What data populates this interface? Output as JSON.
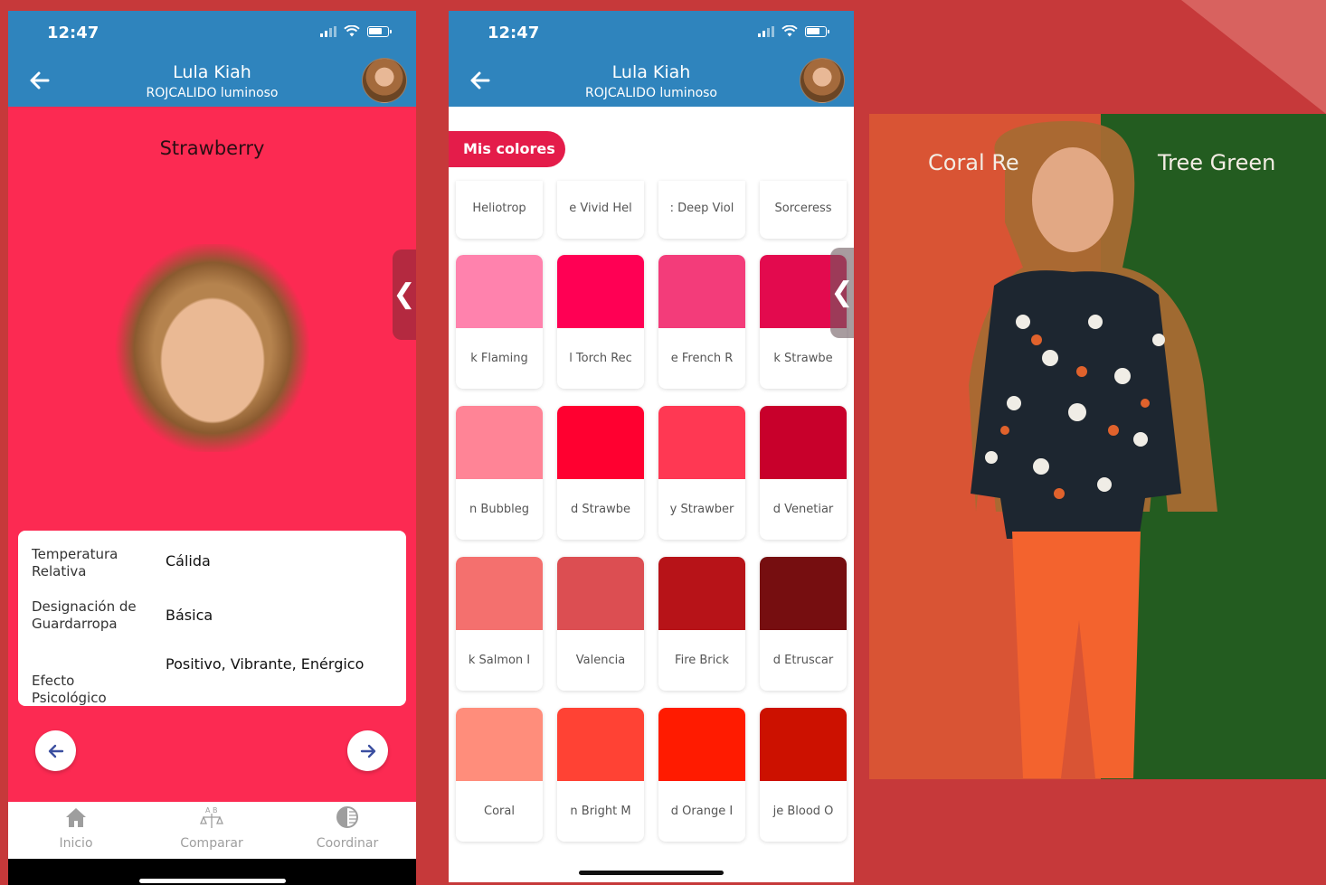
{
  "colors": {
    "background": "#c6393a",
    "header_blue": "#2f84bd",
    "strawberry": "#fc2a52",
    "pill": "#e41c4a"
  },
  "phone1": {
    "status_time": "12:47",
    "header": {
      "name": "Lula Kiah",
      "subtitle": "ROJCALIDO luminoso"
    },
    "color_name": "Strawberry",
    "info": [
      {
        "label": "Temperatura Relativa",
        "value": "Cálida"
      },
      {
        "label": "Designación de Guardarropa",
        "value": "Básica"
      },
      {
        "label": "Efecto Psicológico",
        "value": "Positivo, Vibrante, Enérgico"
      }
    ],
    "nav": [
      {
        "label": "Inicio",
        "icon": "home-icon"
      },
      {
        "label": "Comparar",
        "icon": "compare-icon"
      },
      {
        "label": "Coordinar",
        "icon": "coordinate-icon"
      }
    ]
  },
  "phone2": {
    "status_time": "12:47",
    "header": {
      "name": "Lula Kiah",
      "subtitle": "ROJCALIDO luminoso"
    },
    "section_label": "Mis colores",
    "top_row": [
      "Heliotrop",
      "e Vivid Hel",
      ": Deep Viol",
      "Sorceress"
    ],
    "swatches": [
      {
        "label": "k Flaming",
        "color": "#ff82ad"
      },
      {
        "label": "l Torch Rec",
        "color": "#ff0054"
      },
      {
        "label": "e French R",
        "color": "#f33c7a"
      },
      {
        "label": "k Strawbe",
        "color": "#e30a4e"
      },
      {
        "label": "n Bubbleg",
        "color": "#ff8496"
      },
      {
        "label": "d Strawbe",
        "color": "#ff0030"
      },
      {
        "label": "y Strawber",
        "color": "#ff3853"
      },
      {
        "label": "d Venetiar",
        "color": "#c8002b"
      },
      {
        "label": "k Salmon I",
        "color": "#f4706e"
      },
      {
        "label": "Valencia",
        "color": "#dc4e52"
      },
      {
        "label": "Fire Brick",
        "color": "#b71318"
      },
      {
        "label": "d Etruscar",
        "color": "#760e10"
      },
      {
        "label": "Coral",
        "color": "#ff8d7b"
      },
      {
        "label": "n Bright M",
        "color": "#ff4234"
      },
      {
        "label": "d Orange I",
        "color": "#ff1b00"
      },
      {
        "label": "je Blood O",
        "color": "#cc1100"
      }
    ]
  },
  "compare": {
    "left_label": "Coral Re",
    "right_label": "Tree Green",
    "left_color": "#d95434",
    "right_color": "#235c20"
  }
}
